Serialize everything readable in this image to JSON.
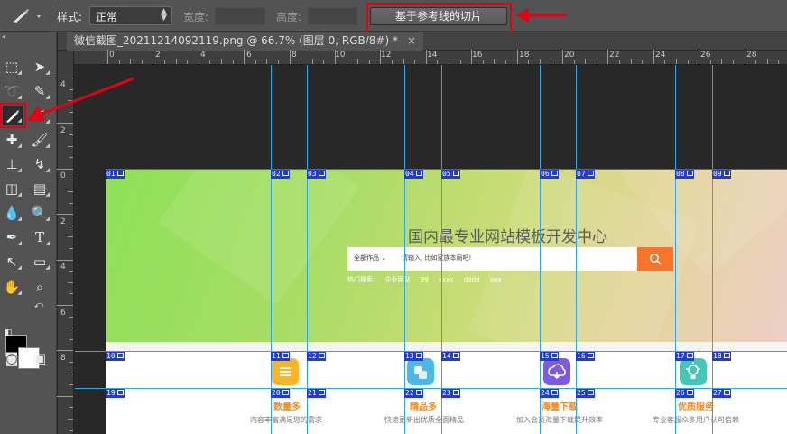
{
  "options_bar": {
    "style_label": "样式:",
    "style_value": "正常",
    "width_label": "宽度:",
    "height_label": "高度:",
    "slice_button": "基于参考线的切片"
  },
  "document": {
    "tab_title": "微信截图_20211214092119.png @ 66.7% (图层 0, RGB/8#) *",
    "close_glyph": "×"
  },
  "rulers": {
    "horizontal": [
      "0",
      "2",
      "4",
      "6",
      "8",
      "10",
      "12",
      "14",
      "16",
      "18",
      "20",
      "22",
      "24",
      "26",
      "28"
    ],
    "vertical": [
      "4",
      "2",
      "0",
      "2",
      "4",
      "6",
      "8"
    ]
  },
  "banner": {
    "title": "国内最专业网站模板开发中心",
    "search_category": "全部作品 ⌄",
    "search_placeholder": "请输入, 比如家族本局吧!",
    "search_button_icon": "search-icon",
    "hot_label": "热门搜索:",
    "hot_terms": [
      "企业网站",
      "99",
      "xxxx",
      "dddd",
      "aaa"
    ]
  },
  "features": [
    {
      "title": "数量多",
      "desc": "内容丰富满足您的需求",
      "icon": "list-icon",
      "color": "#f8b52a"
    },
    {
      "title": "精品多",
      "desc": "快速更新出优质全面精品",
      "icon": "squares-icon",
      "color": "#4bb8e8"
    },
    {
      "title": "海量下载",
      "desc": "加入会员海量下载提升效率",
      "icon": "cloud-download-icon",
      "color": "#7b5be0"
    },
    {
      "title": "优质服务",
      "desc": "专业客服众多用户认可信赖",
      "icon": "lightbulb-icon",
      "color": "#45c7b8"
    }
  ],
  "slices": {
    "row1": [
      "01",
      "02",
      "03",
      "04",
      "05",
      "06",
      "07",
      "08",
      "09"
    ],
    "row2": [
      "10",
      "11",
      "12",
      "13",
      "14",
      "15",
      "16",
      "17",
      "18"
    ],
    "row3": [
      "19",
      "20",
      "21",
      "22",
      "23",
      "24",
      "25",
      "26",
      "27"
    ]
  },
  "colors": {
    "annotation": "#e60012",
    "guide": "#2fa7e6",
    "slice_label": "#1f3bdb",
    "accent_orange": "#f7742a"
  }
}
